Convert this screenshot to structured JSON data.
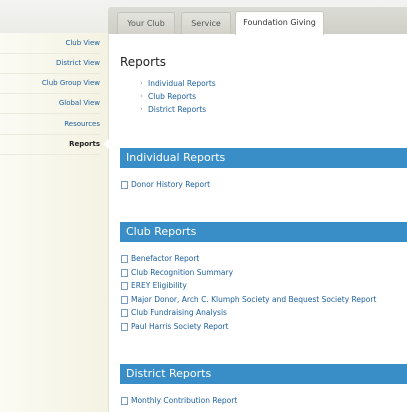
{
  "tabs": [
    "Your Club",
    "Service",
    "Foundation Giving"
  ],
  "sidebar": {
    "items": [
      "Club View",
      "District View",
      "Club Group View",
      "Global View",
      "Resources",
      "Reports"
    ]
  },
  "main": {
    "title": "Reports",
    "toc": [
      "Individual Reports",
      "Club Reports",
      "District Reports"
    ],
    "sections": [
      {
        "heading": "Individual Reports",
        "links": [
          "Donor History Report"
        ]
      },
      {
        "heading": "Club Reports",
        "links": [
          "Benefactor Report",
          "Club Recognition Summary",
          "EREY Eligibility",
          "Major Donor, Arch C. Klumph Society and Bequest Society Report",
          "Club Fundraising Analysis",
          "Paul Harris Society Report"
        ]
      },
      {
        "heading": "District Reports",
        "links": [
          "Monthly Contribution Report"
        ]
      }
    ]
  }
}
